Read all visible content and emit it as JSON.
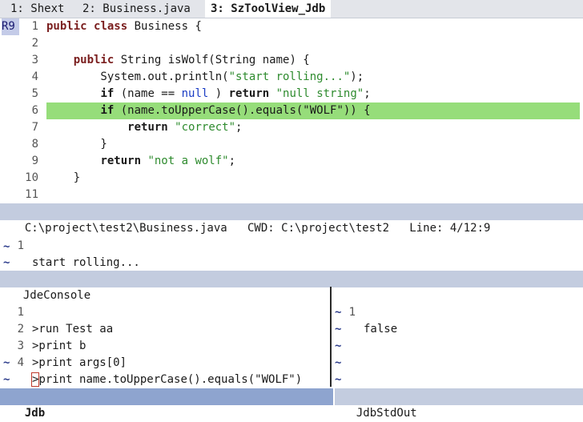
{
  "tabs": [
    {
      "label": "1: Shext",
      "active": false
    },
    {
      "label": "2: Business.java",
      "active": false
    },
    {
      "label": "3: SzToolView_Jdb",
      "active": true
    }
  ],
  "editor": {
    "mark": "R9",
    "line_numbers": [
      "1",
      "2",
      "3",
      "4",
      "5",
      "6",
      "7",
      "8",
      "9",
      "10",
      "11"
    ],
    "highlighted_line": 6,
    "lines": [
      [
        {
          "t": "kw",
          "v": "public"
        },
        {
          "t": "",
          "v": " "
        },
        {
          "t": "kw",
          "v": "class"
        },
        {
          "t": "",
          "v": " Business {"
        }
      ],
      [],
      [
        {
          "t": "",
          "v": "    "
        },
        {
          "t": "kw",
          "v": "public"
        },
        {
          "t": "",
          "v": " String isWolf(String name) {"
        }
      ],
      [
        {
          "t": "",
          "v": "        System.out.println("
        },
        {
          "t": "str",
          "v": "\"start rolling...\""
        },
        {
          "t": "",
          "v": ");"
        }
      ],
      [
        {
          "t": "",
          "v": "        "
        },
        {
          "t": "kwb",
          "v": "if"
        },
        {
          "t": "",
          "v": " (name == "
        },
        {
          "t": "nul",
          "v": "null"
        },
        {
          "t": "",
          "v": " ) "
        },
        {
          "t": "kwb",
          "v": "return"
        },
        {
          "t": "",
          "v": " "
        },
        {
          "t": "str",
          "v": "\"null string\""
        },
        {
          "t": "",
          "v": ";"
        }
      ],
      [
        {
          "t": "",
          "v": "        "
        },
        {
          "t": "kwb",
          "v": "if"
        },
        {
          "t": "",
          "v": " (name.toUpperCase().equals(\"WOLF\")) {"
        }
      ],
      [
        {
          "t": "",
          "v": "            "
        },
        {
          "t": "kwb",
          "v": "return"
        },
        {
          "t": "",
          "v": " "
        },
        {
          "t": "str",
          "v": "\"correct\""
        },
        {
          "t": "",
          "v": ";"
        }
      ],
      [
        {
          "t": "",
          "v": "        }"
        }
      ],
      [
        {
          "t": "",
          "v": "        "
        },
        {
          "t": "kwb",
          "v": "return"
        },
        {
          "t": "",
          "v": " "
        },
        {
          "t": "str",
          "v": "\"not a wolf\""
        },
        {
          "t": "",
          "v": ";"
        }
      ],
      [
        {
          "t": "",
          "v": "    }"
        }
      ],
      []
    ]
  },
  "status_bar": "C:\\project\\test2\\Business.java   CWD: C:\\project\\test2   Line: 4/12:9",
  "output": {
    "line_number": "1",
    "text": "start rolling...",
    "tilde": "~"
  },
  "console_title": "JdeConsole",
  "jdb": {
    "line_numbers": [
      "1",
      "2",
      "3",
      "4"
    ],
    "lines": [
      ">run Test aa",
      ">print b",
      ">print args[0]",
      ">print name.toUpperCase().equals(\"WOLF\")"
    ],
    "cursor_char": ">",
    "last_line_rest": "print name.toUpperCase().equals(\"WOLF\")",
    "tilde": "~",
    "title": "Jdb"
  },
  "stdout": {
    "line_number": "1",
    "text": "false",
    "tilde": "~",
    "title": "JdbStdOut"
  }
}
